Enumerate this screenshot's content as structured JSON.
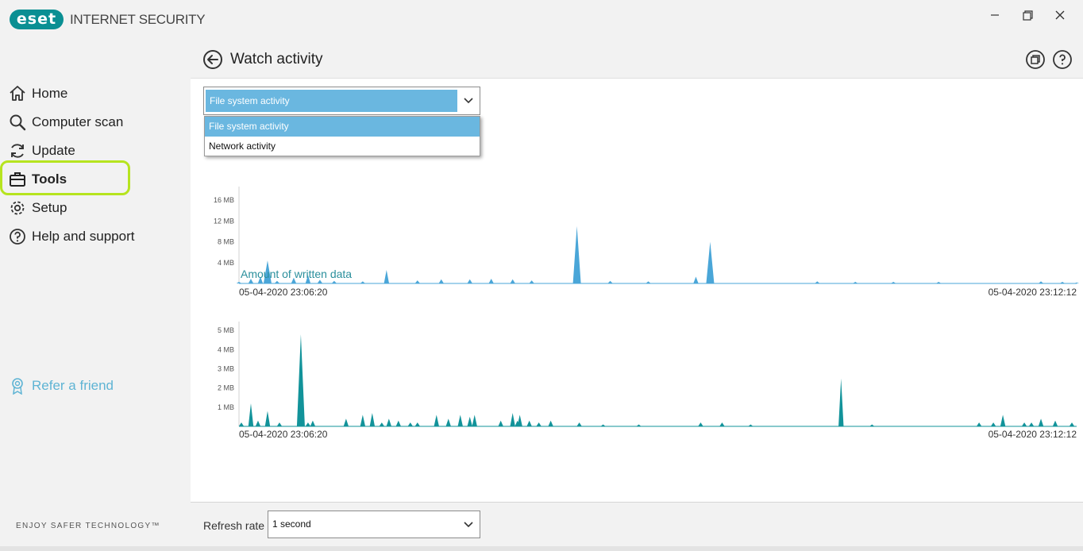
{
  "app": {
    "logo_text": "eset",
    "product_name": "INTERNET SECURITY",
    "brand_color": "#0a8f93"
  },
  "window_controls": [
    "minimize-icon",
    "maximize-icon",
    "close-icon"
  ],
  "sidebar": {
    "items": [
      {
        "label": "Home",
        "icon": "home-icon",
        "active": false
      },
      {
        "label": "Computer scan",
        "icon": "search-icon",
        "active": false
      },
      {
        "label": "Update",
        "icon": "refresh-icon",
        "active": false
      },
      {
        "label": "Tools",
        "icon": "toolbox-icon",
        "active": true
      },
      {
        "label": "Setup",
        "icon": "gear-icon",
        "active": false
      },
      {
        "label": "Help and support",
        "icon": "question-icon",
        "active": false
      }
    ],
    "highlight_color": "#b6e41f",
    "refer_label": "Refer a friend",
    "refer_color": "#5fb4d4",
    "slogan": "ENJOY SAFER TECHNOLOGY™"
  },
  "header": {
    "title": "Watch activity",
    "icons": [
      "back-arrow-icon",
      "detach-window-icon",
      "help-icon"
    ]
  },
  "activity_select": {
    "value": "File system activity",
    "open": true,
    "options": [
      "File system activity",
      "Network activity"
    ],
    "selected_index": 0
  },
  "chart_data": [
    {
      "type": "area",
      "title": "",
      "color": "#4aa6d8",
      "ylabel_ticks": [
        "4 MB",
        "8 MB",
        "12 MB",
        "16 MB"
      ],
      "tick_values": [
        4,
        8,
        12,
        16
      ],
      "ylim": [
        0,
        18
      ],
      "y_unit": "MB",
      "x_start": "05-04-2020 23:06:20",
      "x_end": "05-04-2020 23:12:12",
      "series": [
        {
          "x_sec": [
            0,
            5,
            9,
            12,
            16,
            23,
            29,
            34,
            40,
            52,
            62,
            75,
            85,
            97,
            106,
            115,
            123,
            142,
            156,
            172,
            192,
            198,
            243,
            259,
            275,
            294,
            337,
            346,
            352
          ],
          "values": [
            0.3,
            0.9,
            1.3,
            4.4,
            0.5,
            1.1,
            1.6,
            0.7,
            0.5,
            0.4,
            2.6,
            0.6,
            0.8,
            0.8,
            0.9,
            0.8,
            0.6,
            11.0,
            0.5,
            0.4,
            1.3,
            8.0,
            0.4,
            0.3,
            0.3,
            0.3,
            0.4,
            0.3,
            0.2
          ]
        }
      ]
    },
    {
      "type": "area",
      "title": "Amount of written data",
      "color": "#12939a",
      "ylabel_ticks": [
        "1 MB",
        "2 MB",
        "3 MB",
        "4 MB",
        "5 MB"
      ],
      "tick_values": [
        1,
        2,
        3,
        4,
        5
      ],
      "ylim": [
        0,
        5.3
      ],
      "y_unit": "MB",
      "x_start": "05-04-2020 23:06:20",
      "x_end": "05-04-2020 23:12:12",
      "series": [
        {
          "x_sec": [
            1,
            5,
            8,
            12,
            17,
            26,
            29,
            31,
            45,
            52,
            56,
            60,
            63,
            67,
            72,
            75,
            83,
            88,
            93,
            97,
            99,
            110,
            115,
            117,
            118,
            122,
            126,
            131,
            143,
            153,
            168,
            194,
            203,
            215,
            253,
            266,
            311,
            317,
            321,
            330,
            333,
            337,
            343,
            350
          ],
          "values": [
            0.2,
            1.2,
            0.3,
            0.8,
            0.2,
            4.8,
            0.2,
            0.3,
            0.4,
            0.6,
            0.7,
            0.2,
            0.4,
            0.3,
            0.2,
            0.2,
            0.6,
            0.4,
            0.6,
            0.5,
            0.6,
            0.3,
            0.7,
            0.3,
            0.6,
            0.3,
            0.2,
            0.3,
            0.2,
            0.1,
            0.1,
            0.2,
            0.2,
            0.1,
            2.5,
            0.1,
            0.2,
            0.2,
            0.6,
            0.2,
            0.2,
            0.4,
            0.3,
            0.2
          ]
        }
      ]
    }
  ],
  "footer": {
    "refresh_label": "Refresh rate",
    "refresh_value": "1 second"
  }
}
